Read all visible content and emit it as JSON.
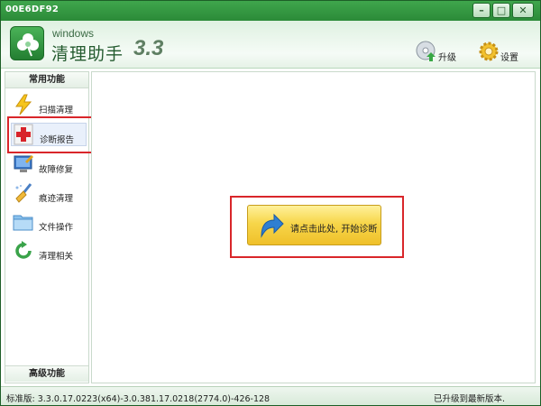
{
  "window": {
    "title": "00E6DF92"
  },
  "titlebar_buttons": {
    "minimize": "–",
    "maximize": "□",
    "close": "✕"
  },
  "header": {
    "subtitle": "windows",
    "app_name": "清理助手",
    "version": "3.3",
    "upgrade_label": "升级",
    "settings_label": "设置"
  },
  "sidebar": {
    "common_header": "常用功能",
    "advanced_header": "高级功能",
    "items": [
      {
        "label": "扫描清理",
        "icon": "lightning-icon"
      },
      {
        "label": "诊断报告",
        "icon": "red-cross-icon"
      },
      {
        "label": "故障修复",
        "icon": "computer-repair-icon"
      },
      {
        "label": "痕迹清理",
        "icon": "broom-icon"
      },
      {
        "label": "文件操作",
        "icon": "folder-icon"
      },
      {
        "label": "清理相关",
        "icon": "refresh-icon"
      }
    ]
  },
  "main": {
    "start_button_label": "请点击此处, 开始诊断"
  },
  "status": {
    "version_info": "标准版: 3.3.0.17.0223(x64)-3.0.381.17.0218(2774.0)-426-128",
    "update_status": "已升级到最新版本."
  },
  "colors": {
    "title_green": "#2b8a38",
    "highlight_red": "#d9262a",
    "button_yellow": "#f7d64a"
  }
}
